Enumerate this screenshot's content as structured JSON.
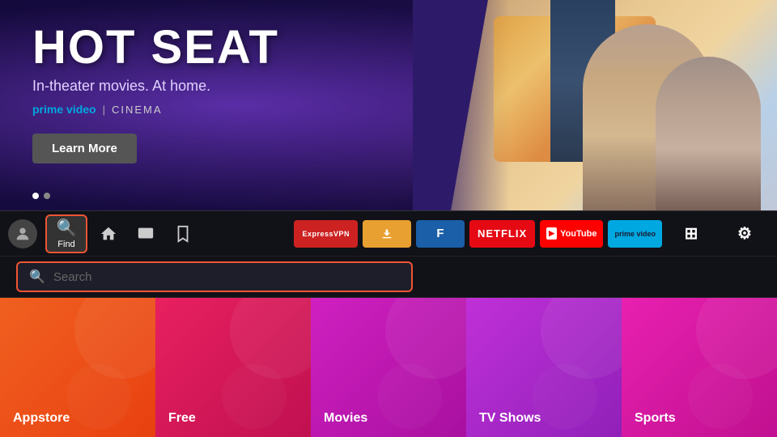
{
  "hero": {
    "title": "HOT SEAT",
    "subtitle": "In-theater movies. At home.",
    "brand_prime": "prime video",
    "brand_divider": "|",
    "brand_cinema": "CINEMA",
    "learn_more": "Learn More",
    "dots": [
      {
        "active": true
      },
      {
        "active": false
      }
    ]
  },
  "navbar": {
    "find_label": "Find",
    "icons": {
      "home": "⌂",
      "tv": "📺",
      "bookmark": "🔖"
    },
    "apps": [
      {
        "id": "expressvpn",
        "label": "ExpressVPN",
        "class": "app-expressvpn"
      },
      {
        "id": "downloader",
        "label": "⬇",
        "class": "app-downloader"
      },
      {
        "id": "blue",
        "label": "F",
        "class": "app-blue"
      },
      {
        "id": "netflix",
        "label": "NETFLIX",
        "class": "app-netflix"
      },
      {
        "id": "youtube",
        "label": "YouTube",
        "class": "app-youtube"
      },
      {
        "id": "prime",
        "label": "prime video",
        "class": "app-prime"
      }
    ]
  },
  "search": {
    "placeholder": "Search"
  },
  "categories": [
    {
      "id": "appstore",
      "label": "Appstore",
      "class": "cat-appstore"
    },
    {
      "id": "free",
      "label": "Free",
      "class": "cat-free"
    },
    {
      "id": "movies",
      "label": "Movies",
      "class": "cat-movies"
    },
    {
      "id": "tvshows",
      "label": "TV Shows",
      "class": "cat-tvshows"
    },
    {
      "id": "sports",
      "label": "Sports",
      "class": "cat-sports"
    }
  ]
}
